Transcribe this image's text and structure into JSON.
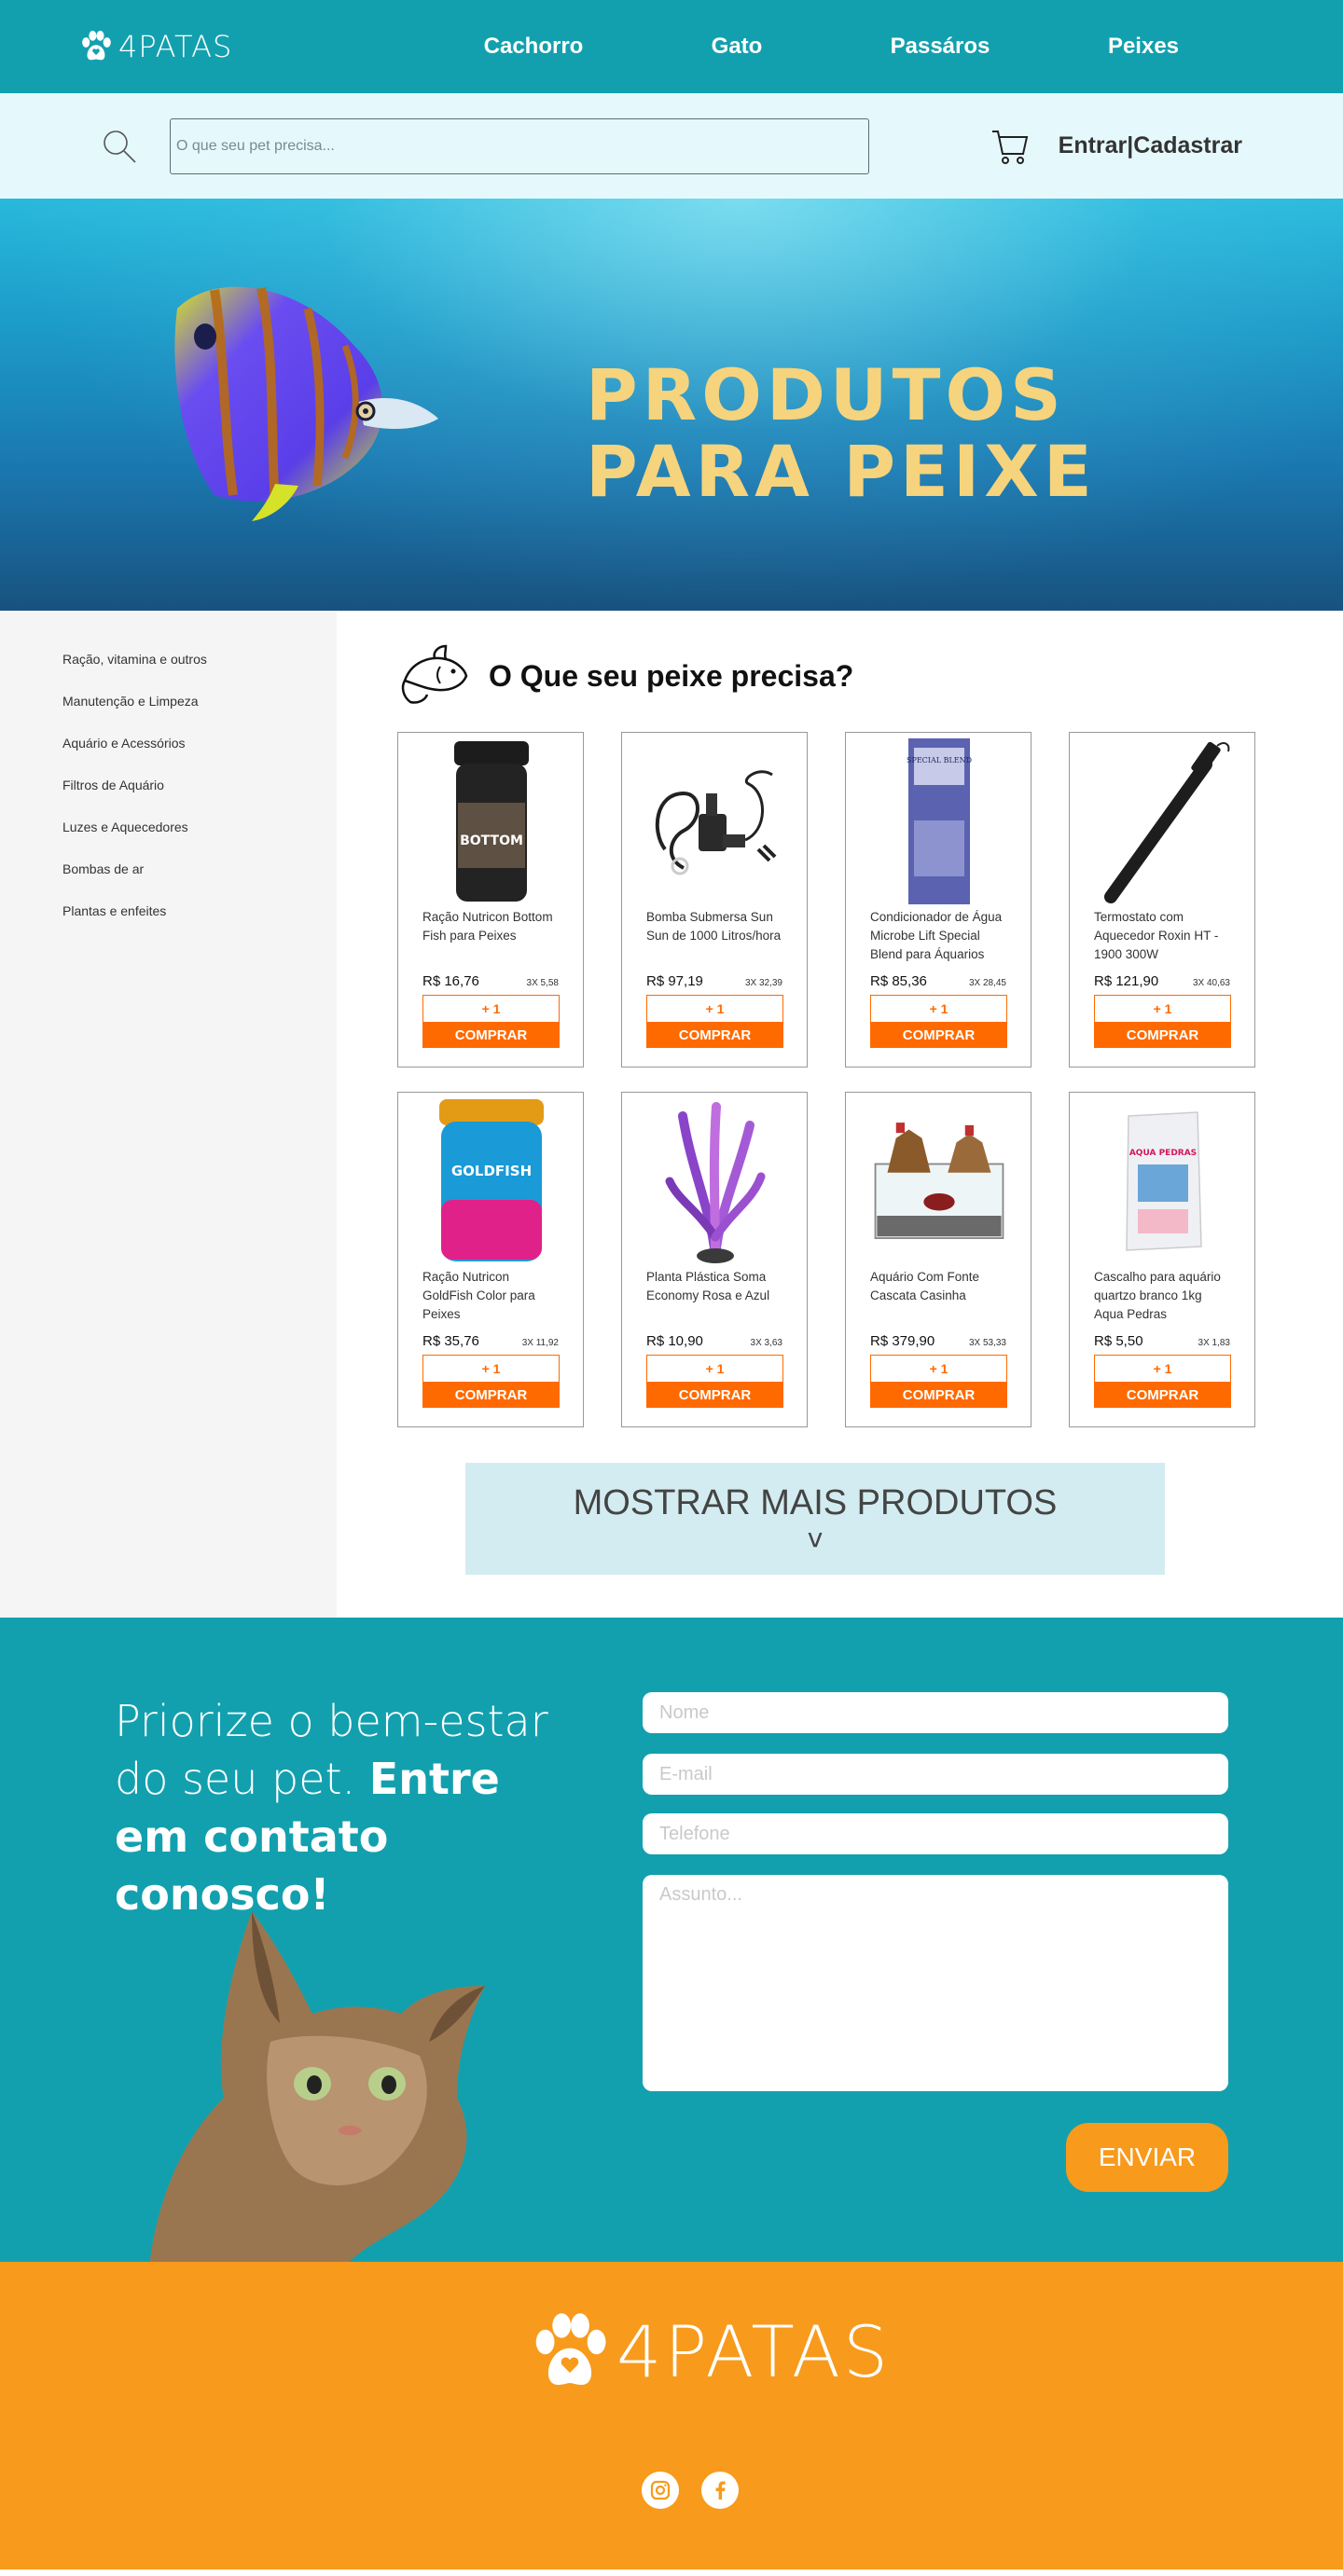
{
  "brand": {
    "logo_text": "4PATAS"
  },
  "nav": {
    "items": [
      "Cachorro",
      "Gato",
      "Passáros",
      "Peixes"
    ]
  },
  "search": {
    "placeholder": "O que seu pet precisa..."
  },
  "auth": {
    "label": "Entrar|Cadastrar"
  },
  "hero": {
    "line1": "PRODUTOS",
    "line2": "PARA PEIXE"
  },
  "sidebar": {
    "items": [
      "Ração, vitamina e outros",
      "Manutenção e Limpeza",
      "Aquário e Acessórios",
      "Filtros de Aquário",
      "Luzes e Aquecedores",
      "Bombas de ar",
      "Plantas e enfeites"
    ]
  },
  "section": {
    "title": "O Que seu peixe precisa?"
  },
  "buttons": {
    "plus": "+ 1",
    "buy": "COMPRAR"
  },
  "products": [
    {
      "name": "Ração Nutricon Bottom Fish para Peixes",
      "price": "R$ 16,76",
      "installment": "3X 5,58",
      "image": "food-jar-black",
      "img_text": "BOTTOM"
    },
    {
      "name": "Bomba Submersa Sun Sun de 1000 Litros/hora",
      "price": "R$ 97,19",
      "installment": "3X 32,39",
      "image": "pump",
      "img_text": ""
    },
    {
      "name": "Condicionador de Água Microbe Lift Special Blend para Áquarios",
      "price": "R$ 85,36",
      "installment": "3X 28,45",
      "image": "bottle-blue",
      "img_text": "SPECIAL BLEND"
    },
    {
      "name": "Termostato com Aquecedor Roxin HT - 1900 300W",
      "price": "R$ 121,90",
      "installment": "3X 40,63",
      "image": "heater",
      "img_text": ""
    },
    {
      "name": "Ração Nutricon GoldFish Color para Peixes",
      "price": "R$ 35,76",
      "installment": "3X 11,92",
      "image": "food-jar-goldfish",
      "img_text": "GOLDFISH"
    },
    {
      "name": "Planta Plástica Soma Economy Rosa e Azul",
      "price": "R$ 10,90",
      "installment": "3X 3,63",
      "image": "plant",
      "img_text": ""
    },
    {
      "name": "Aquário Com Fonte Cascata Casinha",
      "price": "R$ 379,90",
      "installment": "3X 53,33",
      "image": "aquarium",
      "img_text": ""
    },
    {
      "name": "Cascalho para aquário quartzo branco 1kg Aqua Pedras",
      "price": "R$ 5,50",
      "installment": "3X 1,83",
      "image": "gravel-bag",
      "img_text": "AQUA PEDRAS"
    }
  ],
  "more": {
    "label": "MOSTRAR MAIS PRODUTOS",
    "chevron": "v"
  },
  "contact": {
    "text_normal": "Priorize o bem-estar do seu pet. ",
    "text_bold": "Entre em contato conosco!",
    "name_placeholder": "Nome",
    "email_placeholder": "E-mail",
    "phone_placeholder": "Telefone",
    "subject_placeholder": "Assunto...",
    "send_label": "ENVIAR"
  },
  "footer": {
    "logo_text": "4PATAS",
    "social": [
      "instagram-icon",
      "facebook-icon"
    ]
  },
  "colors": {
    "teal": "#13a0ae",
    "light_teal": "#e5f9fc",
    "orange": "#ff6a00",
    "footer_orange": "#f89a1c",
    "hero_text": "#f6d37d"
  }
}
